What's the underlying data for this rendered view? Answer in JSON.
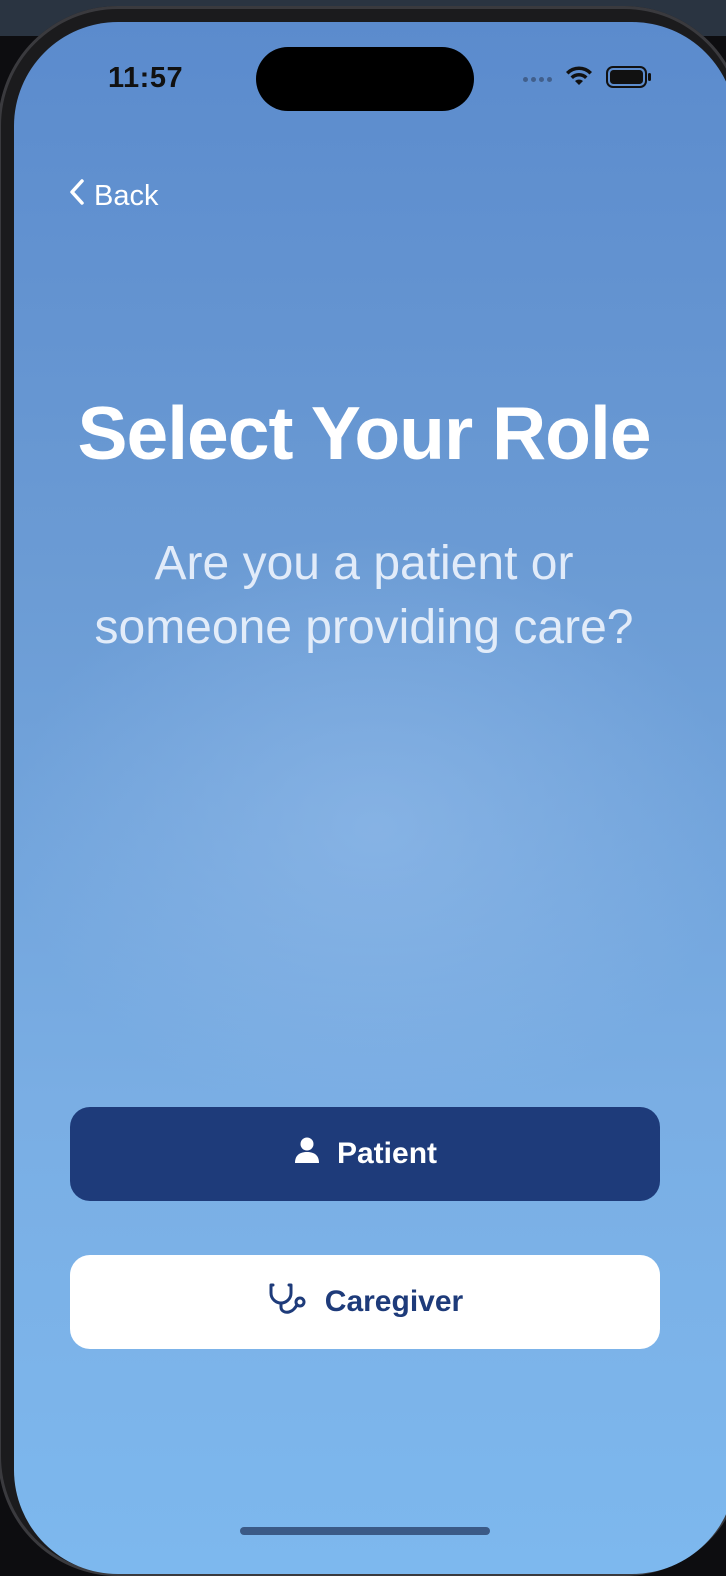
{
  "status_bar": {
    "time": "11:57",
    "icons": [
      "signal-dots-icon",
      "wifi-icon",
      "battery-icon"
    ]
  },
  "nav": {
    "back_label": "Back",
    "back_icon": "chevron-left-icon"
  },
  "header": {
    "title": "Select Your Role",
    "subtitle": "Are you a patient or someone providing care?"
  },
  "roles": [
    {
      "label": "Patient",
      "icon": "person-icon",
      "style": "primary"
    },
    {
      "label": "Caregiver",
      "icon": "stethoscope-icon",
      "style": "secondary"
    }
  ],
  "colors": {
    "primary_button": "#1e3b7a",
    "secondary_button": "#ffffff",
    "background_top": "#5b8bcd",
    "background_bottom": "#7db8ee",
    "text": "#ffffff"
  }
}
